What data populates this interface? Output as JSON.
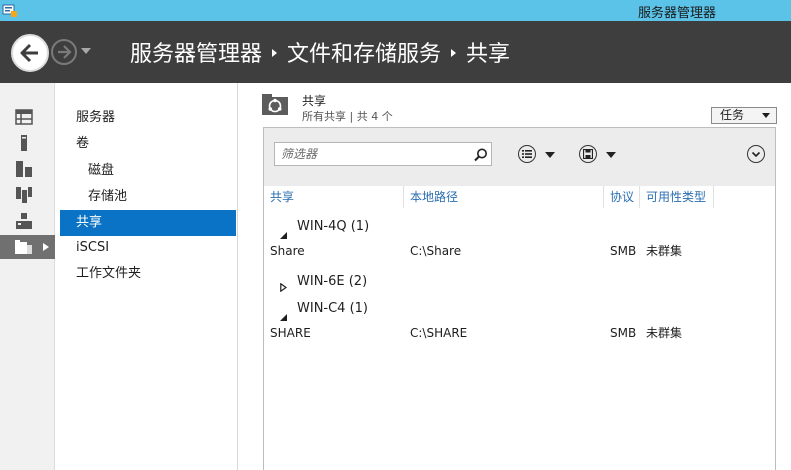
{
  "window": {
    "title": "服务器管理器"
  },
  "header": {
    "breadcrumb": [
      {
        "label": "服务器管理器"
      },
      {
        "label": "文件和存储服务"
      },
      {
        "label": "共享"
      }
    ]
  },
  "rail": {
    "items": [
      {
        "icon": "dashboard-icon"
      },
      {
        "icon": "local-server-icon"
      },
      {
        "icon": "all-servers-icon"
      },
      {
        "icon": "server-group-icon"
      },
      {
        "icon": "server-role-icon"
      },
      {
        "icon": "file-storage-icon"
      }
    ]
  },
  "nav": {
    "items": [
      {
        "label": "服务器"
      },
      {
        "label": "卷"
      },
      {
        "label": "磁盘"
      },
      {
        "label": "存储池"
      },
      {
        "label": "共享"
      },
      {
        "label": "iSCSI"
      },
      {
        "label": "工作文件夹"
      }
    ]
  },
  "tile": {
    "title": "共享",
    "subtitle": "所有共享 | 共 4 个",
    "tasks_label": "任务",
    "filter": {
      "placeholder": "筛选器"
    },
    "columns": [
      {
        "label": "共享"
      },
      {
        "label": "本地路径"
      },
      {
        "label": "协议"
      },
      {
        "label": "可用性类型"
      }
    ],
    "groups": [
      {
        "label": "WIN-4Q (1)",
        "expanded": true,
        "rows": [
          {
            "share": "Share",
            "path": "C:\\Share",
            "protocol": "SMB",
            "availability": "未群集"
          }
        ]
      },
      {
        "label": "WIN-6E (2)",
        "expanded": false,
        "rows": []
      },
      {
        "label": "WIN-C4 (1)",
        "expanded": true,
        "rows": [
          {
            "share": "SHARE",
            "path": "C:\\SHARE",
            "protocol": "SMB",
            "availability": "未群集"
          }
        ]
      }
    ]
  },
  "colors": {
    "titlebar": "#5bc3e8",
    "header": "#3e3e3e",
    "selected_nav": "#0a73c6",
    "column_header_text": "#2a6eb0"
  }
}
